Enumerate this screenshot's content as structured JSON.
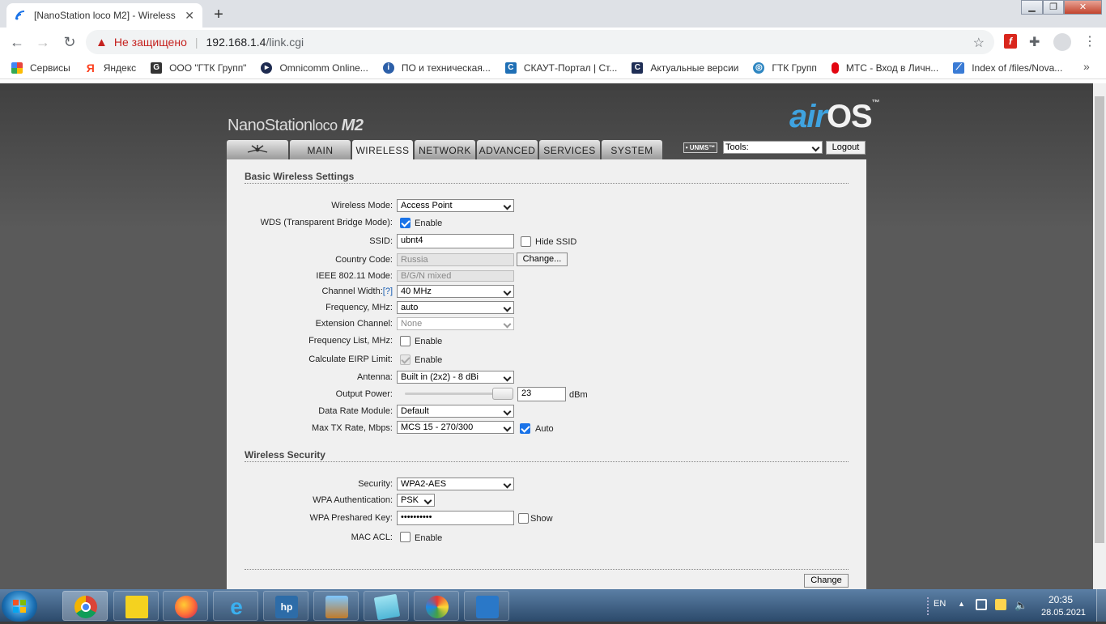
{
  "browser": {
    "tab_title": "[NanoStation loco M2] - Wireless",
    "new_tab": "+",
    "not_secure": "Не защищено",
    "url_host": "192.168.1.4",
    "url_path": "/link.cgi",
    "bookmarks": [
      {
        "label": "Сервисы",
        "icon": "apps-grid-icon",
        "color": "#e8453c"
      },
      {
        "label": "Яндекс",
        "icon": "yandex-icon",
        "color": "#fc3f1d"
      },
      {
        "label": "ООО \"ГТК Групп\"",
        "icon": "gtk-icon",
        "color": "#333333"
      },
      {
        "label": "Omnicomm Online...",
        "icon": "omnicomm-icon",
        "color": "#1e2b50"
      },
      {
        "label": "ПО и техническая...",
        "icon": "info-icon",
        "color": "#2c5fa8"
      },
      {
        "label": "СКАУТ-Портал | Ст...",
        "icon": "scout-icon",
        "color": "#1f6fb5"
      },
      {
        "label": "Актуальные версии",
        "icon": "versions-icon",
        "color": "#1f2e55"
      },
      {
        "label": "ГТК Групп",
        "icon": "globe-icon",
        "color": "#2e86c1"
      },
      {
        "label": "МТС - Вход в Личн...",
        "icon": "mts-icon",
        "color": "#e30611"
      },
      {
        "label": "Index of /files/Nova...",
        "icon": "novatek-icon",
        "color": "#3a7bd5"
      }
    ]
  },
  "header": {
    "logo_main": "NanoStation",
    "logo_sub": "loco",
    "logo_model": "M2",
    "brand_air": "air",
    "brand_os": "OS",
    "tm": "™",
    "tabs": [
      {
        "label": "",
        "icon": "ubiquiti-logo-icon"
      },
      {
        "label": "MAIN"
      },
      {
        "label": "WIRELESS"
      },
      {
        "label": "NETWORK"
      },
      {
        "label": "ADVANCED"
      },
      {
        "label": "SERVICES"
      },
      {
        "label": "SYSTEM"
      }
    ],
    "unms": "UNMS",
    "tools": "Tools:",
    "logout": "Logout"
  },
  "basic": {
    "title": "Basic Wireless Settings",
    "wireless_mode_label": "Wireless Mode:",
    "wireless_mode": "Access Point",
    "wds_label": "WDS (Transparent Bridge Mode):",
    "enable": "Enable",
    "ssid_label": "SSID:",
    "ssid": "ubnt4",
    "hide_ssid": "Hide SSID",
    "country_label": "Country Code:",
    "country": "Russia",
    "change_btn": "Change...",
    "ieee_label": "IEEE 802.11 Mode:",
    "ieee": "B/G/N mixed",
    "channel_width_label": "Channel Width:",
    "channel_width_help": "[?]",
    "channel_width": "40 MHz",
    "freq_label": "Frequency, MHz:",
    "freq": "auto",
    "ext_channel_label": "Extension Channel:",
    "ext_channel": "None",
    "freq_list_label": "Frequency List, MHz:",
    "eirp_label": "Calculate EIRP Limit:",
    "antenna_label": "Antenna:",
    "antenna": "Built in (2x2) - 8 dBi",
    "output_power_label": "Output Power:",
    "output_power": "23",
    "output_power_fraction": 1.0,
    "dbm": "dBm",
    "data_rate_label": "Data Rate Module:",
    "data_rate": "Default",
    "max_tx_label": "Max TX Rate, Mbps:",
    "max_tx": "MCS 15 - 270/300",
    "auto": "Auto"
  },
  "security": {
    "title": "Wireless Security",
    "security_label": "Security:",
    "security": "WPA2-AES",
    "wpa_auth_label": "WPA Authentication:",
    "wpa_auth": "PSK",
    "wpa_key_label": "WPA Preshared Key:",
    "wpa_key": "••••••••••",
    "show": "Show",
    "mac_acl_label": "MAC ACL:",
    "enable": "Enable"
  },
  "footer": {
    "change": "Change"
  },
  "taskbar": {
    "lang": "EN",
    "time": "20:35",
    "date": "28.05.2021"
  }
}
